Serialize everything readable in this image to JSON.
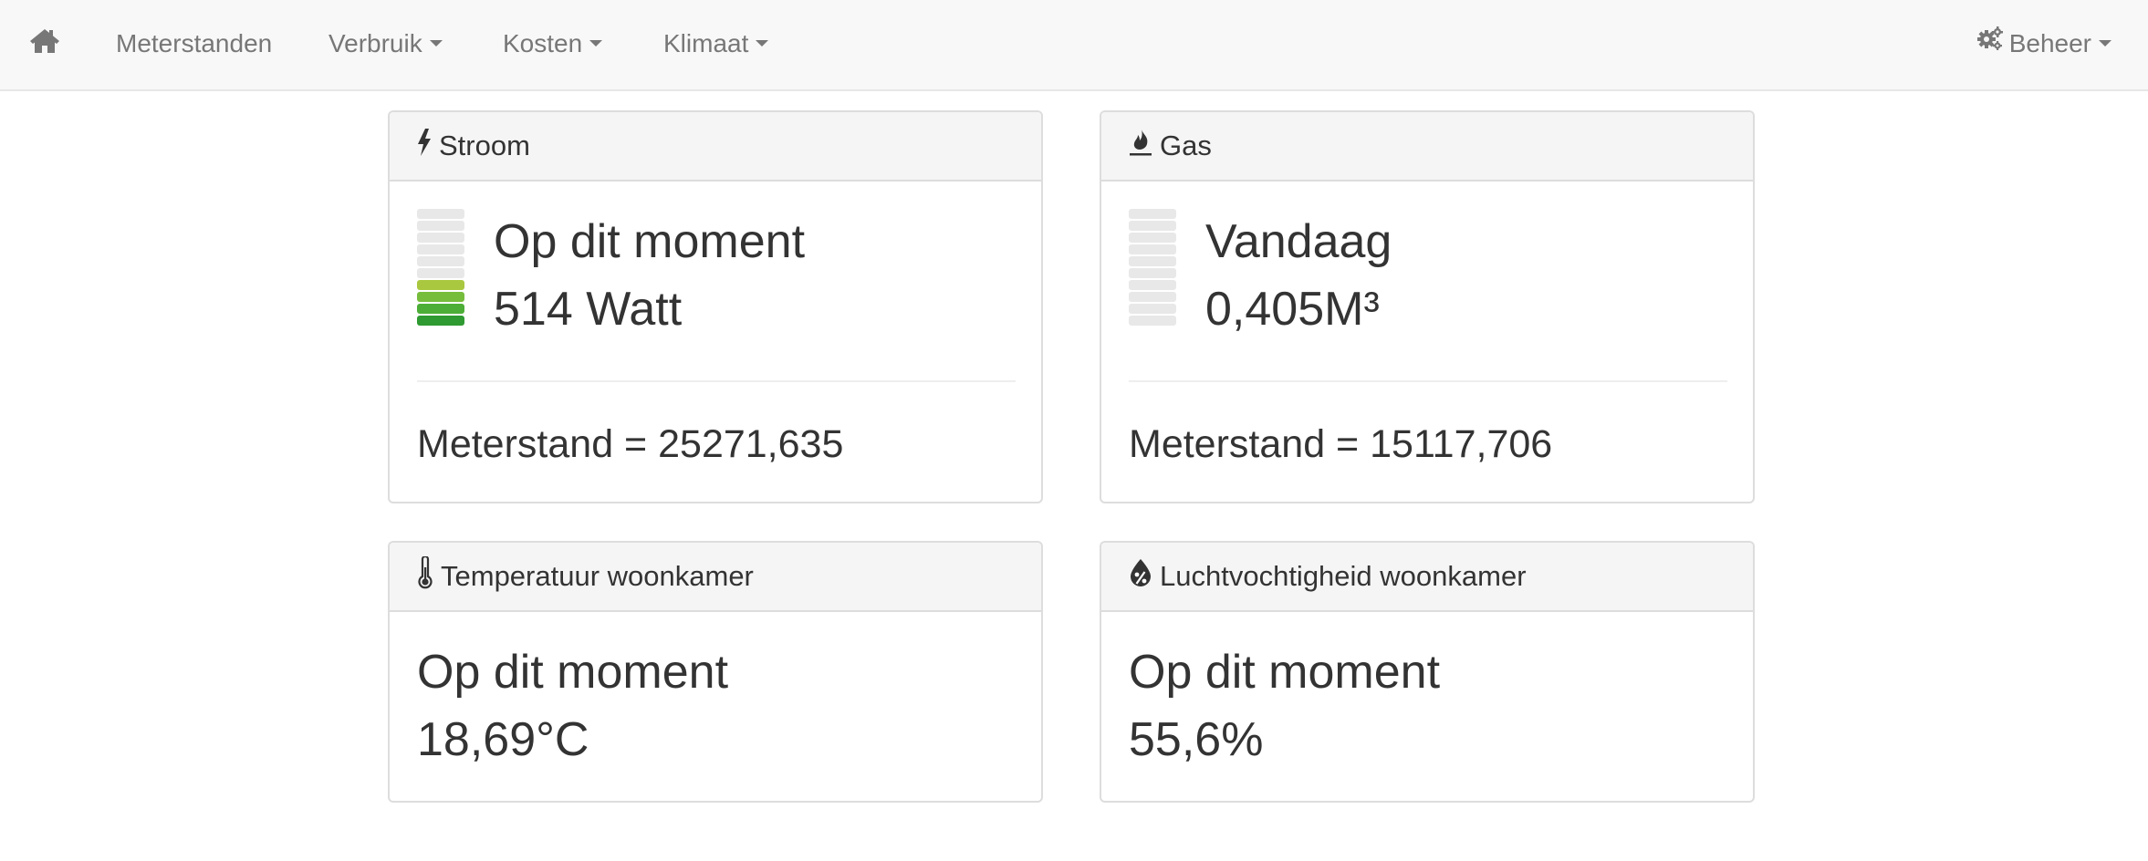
{
  "nav": {
    "home_icon": "home-icon",
    "items": [
      {
        "label": "Meterstanden",
        "dropdown": false
      },
      {
        "label": "Verbruik",
        "dropdown": true
      },
      {
        "label": "Kosten",
        "dropdown": true
      },
      {
        "label": "Klimaat",
        "dropdown": true
      }
    ],
    "beheer": {
      "label": "Beheer",
      "icon": "gears-icon",
      "dropdown": true
    }
  },
  "panels": {
    "stroom": {
      "title": "Stroom",
      "icon": "bolt-icon",
      "caption": "Op dit moment",
      "value": "514 Watt",
      "meter_level": 0.4,
      "meter_segments": 10,
      "meter_colors": [
        "#2e9a31",
        "#4dae37",
        "#76bd3c",
        "#a9c83f"
      ],
      "meterstand": "Meterstand = 25271,635"
    },
    "gas": {
      "title": "Gas",
      "icon": "fire-icon",
      "caption": "Vandaag",
      "value": "0,405M³",
      "meter_level": 0.0,
      "meter_segments": 10,
      "meterstand": "Meterstand = 15117,706"
    },
    "temperatuur": {
      "title": "Temperatuur woonkamer",
      "icon": "thermometer-icon",
      "caption": "Op dit moment",
      "value": "18,69°C"
    },
    "luchtvochtigheid": {
      "title": "Luchtvochtigheid woonkamer",
      "icon": "humidity-icon",
      "caption": "Op dit moment",
      "value": "55,6%"
    }
  },
  "colors": {
    "navbar_bg": "#f8f8f8",
    "nav_text": "#777777",
    "panel_heading_bg": "#f5f5f5",
    "meter_empty": "#e8e8e8"
  }
}
